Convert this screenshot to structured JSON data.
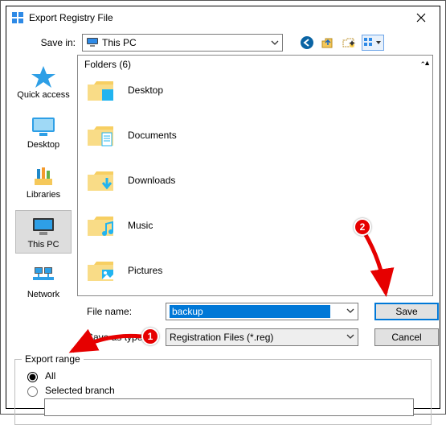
{
  "window": {
    "title": "Export Registry File"
  },
  "savein": {
    "label": "Save in:",
    "value": "This PC",
    "tool_icons": [
      "back-icon",
      "up-one-level-icon",
      "new-folder-icon",
      "view-menu-icon"
    ]
  },
  "places": [
    {
      "id": "quick-access",
      "label": "Quick access"
    },
    {
      "id": "desktop",
      "label": "Desktop"
    },
    {
      "id": "libraries",
      "label": "Libraries"
    },
    {
      "id": "this-pc",
      "label": "This PC",
      "selected": true
    },
    {
      "id": "network",
      "label": "Network"
    }
  ],
  "folders": {
    "header": "Folders (6)",
    "items": [
      {
        "name": "Desktop",
        "accent": "#22b4f0"
      },
      {
        "name": "Documents",
        "accent": "#22b4f0"
      },
      {
        "name": "Downloads",
        "accent": "#22b4f0"
      },
      {
        "name": "Music",
        "accent": "#22b4f0"
      },
      {
        "name": "Pictures",
        "accent": "#22b4f0"
      }
    ]
  },
  "fields": {
    "filename_label": "File name:",
    "filename_value": "backup",
    "type_label": "Save as type:",
    "type_value": "Registration Files (*.reg)",
    "save_label": "Save",
    "cancel_label": "Cancel"
  },
  "export_range": {
    "legend": "Export range",
    "all_label": "All",
    "selected_branch_label": "Selected branch",
    "selected_option": "all",
    "branch_value": ""
  },
  "annotations": {
    "1": "1",
    "2": "2"
  }
}
